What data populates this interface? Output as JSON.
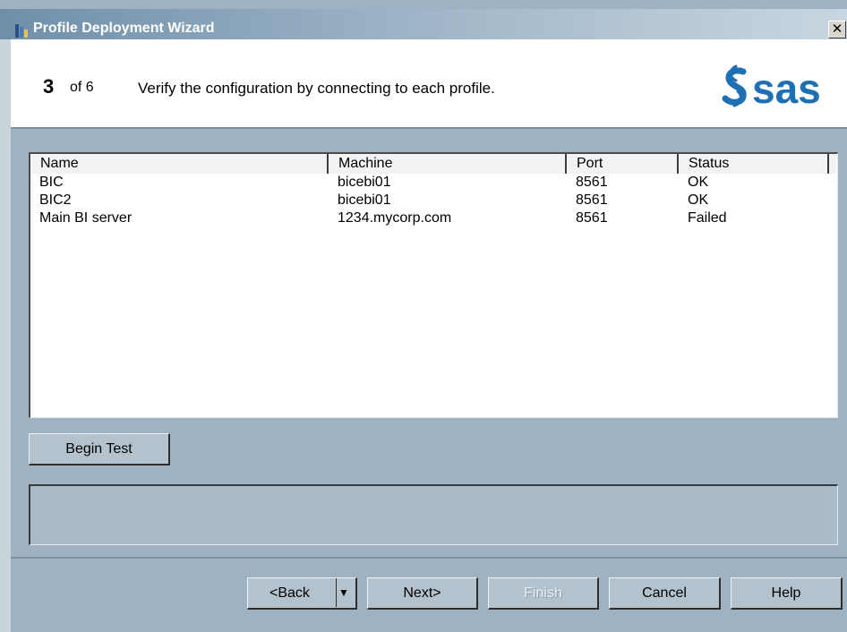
{
  "window": {
    "title": "Profile Deployment Wizard",
    "close_glyph": "✕"
  },
  "header": {
    "step_number": "3",
    "step_of": "of 6",
    "description": "Verify the configuration by connecting to each profile.",
    "logo_text": "sas"
  },
  "profiles_table": {
    "columns": [
      "Name",
      "Machine",
      "Port",
      "Status"
    ],
    "rows": [
      {
        "name": "BIC",
        "machine": "bicebi01",
        "port": "8561",
        "status": "OK"
      },
      {
        "name": "BIC2",
        "machine": "bicebi01",
        "port": "8561",
        "status": "OK"
      },
      {
        "name": "Main BI server",
        "machine": "1234.mycorp.com",
        "port": "8561",
        "status": "Failed"
      }
    ]
  },
  "actions": {
    "begin_test": "Begin Test"
  },
  "status_message": "",
  "footer": {
    "back": "<Back",
    "back_dropdown_glyph": "▼",
    "next": "Next>",
    "finish": "Finish",
    "cancel": "Cancel",
    "help": "Help"
  },
  "colors": {
    "window_bg": "#9fb2c1",
    "logo_blue": "#1f6fb5"
  }
}
